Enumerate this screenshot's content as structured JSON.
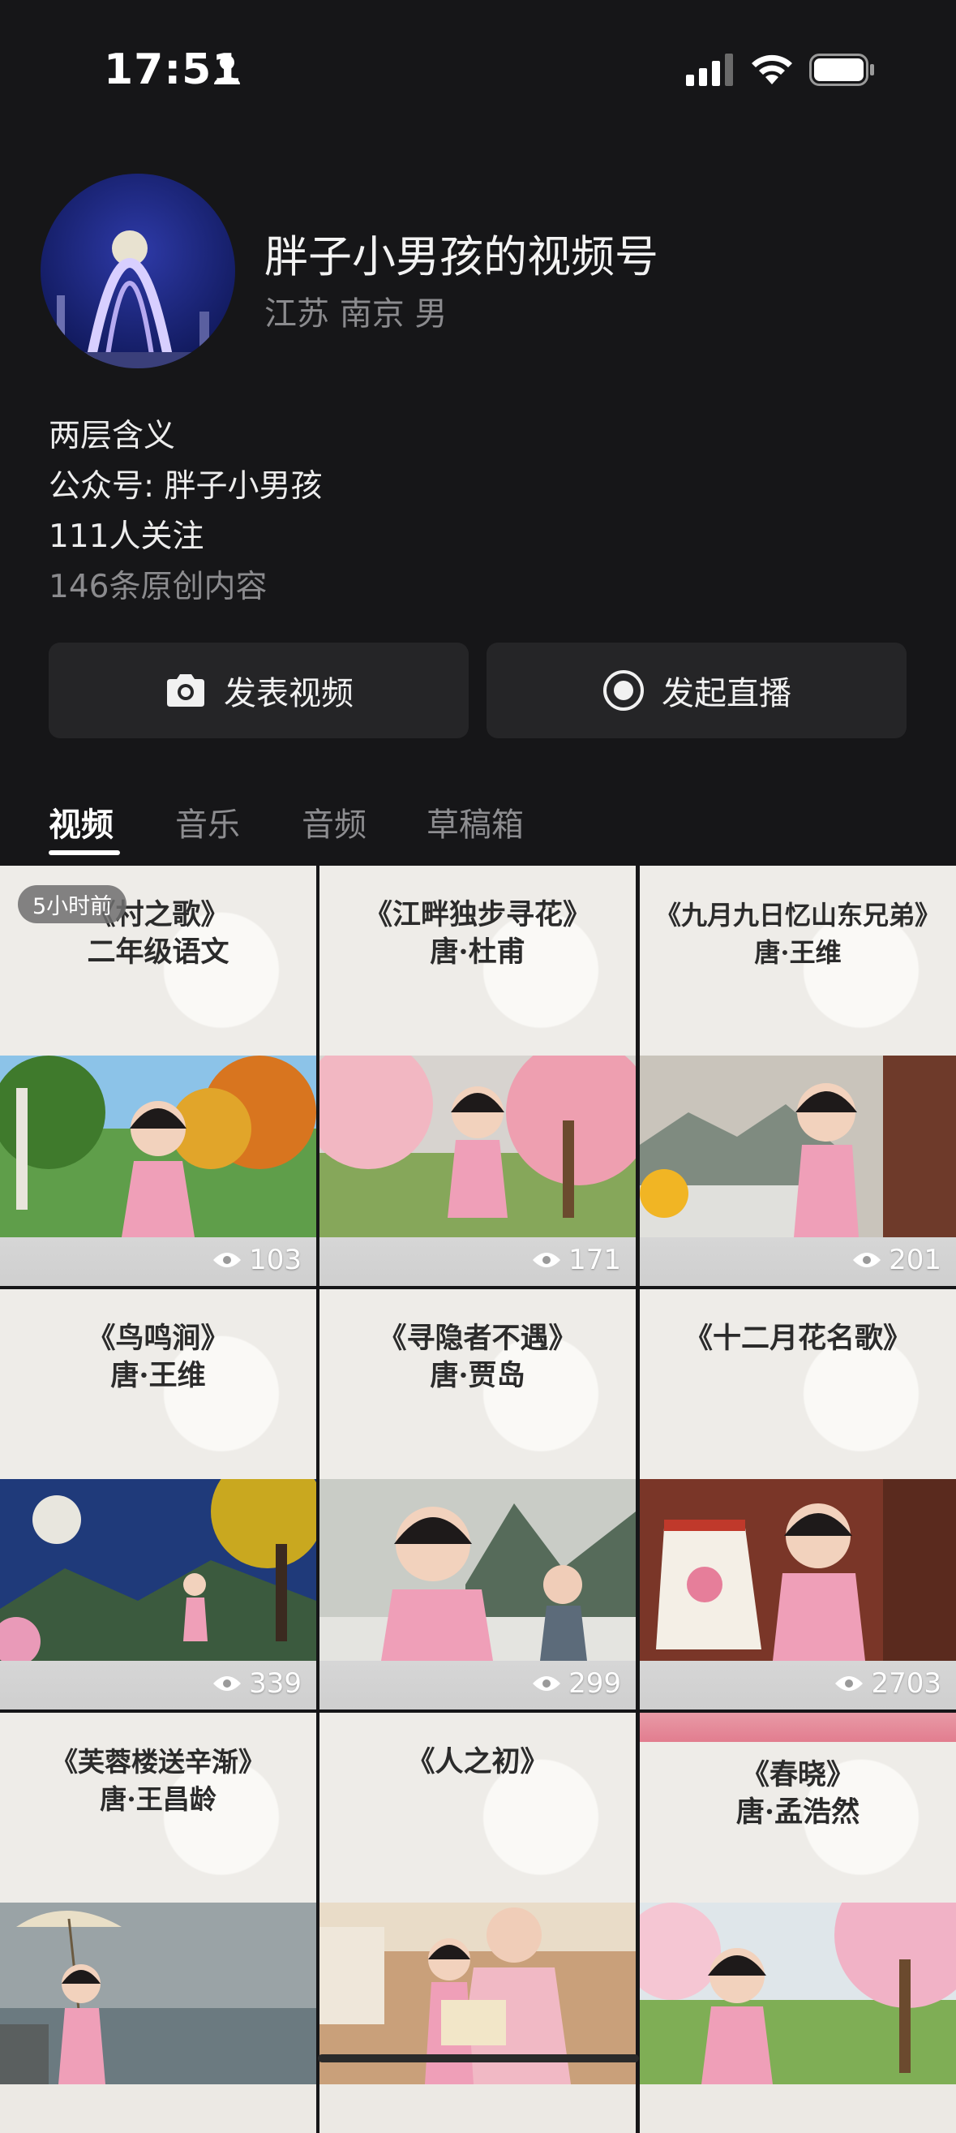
{
  "status_bar": {
    "time": "17:51"
  },
  "profile": {
    "name": "胖子小男孩的视频号",
    "location": "江苏 南京 男",
    "bio_line1": "两层含义",
    "bio_line2": "公众号: 胖子小男孩",
    "followers": "111人关注",
    "original_count": "146条原创内容"
  },
  "actions": {
    "post_video": "发表视频",
    "start_live": "发起直播"
  },
  "tabs": [
    {
      "label": "视频",
      "active": true
    },
    {
      "label": "音乐",
      "active": false
    },
    {
      "label": "音频",
      "active": false
    },
    {
      "label": "草稿箱",
      "active": false
    }
  ],
  "videos": [
    {
      "title1": "《村之歌》",
      "title2": "二年级语文",
      "views": "103",
      "badge": "5小时前"
    },
    {
      "title1": "《江畔独步寻花》",
      "title2": "唐·杜甫",
      "views": "171"
    },
    {
      "title1": "《九月九日忆山东兄弟》",
      "title2": "唐·王维",
      "views": "201"
    },
    {
      "title1": "《鸟鸣涧》",
      "title2": "唐·王维",
      "views": "339"
    },
    {
      "title1": "《寻隐者不遇》",
      "title2": "唐·贾岛",
      "views": "299"
    },
    {
      "title1": "《十二月花名歌》",
      "title2": "",
      "views": "2703"
    },
    {
      "title1": "《芙蓉楼送辛渐》",
      "title2": "唐·王昌龄",
      "views": ""
    },
    {
      "title1": "《人之初》",
      "title2": "",
      "views": ""
    },
    {
      "title1": "《春晓》",
      "title2": "唐·孟浩然",
      "views": ""
    }
  ],
  "colors": {
    "background": "#161618",
    "button": "#252527",
    "muted_text": "#8b8b8e"
  }
}
